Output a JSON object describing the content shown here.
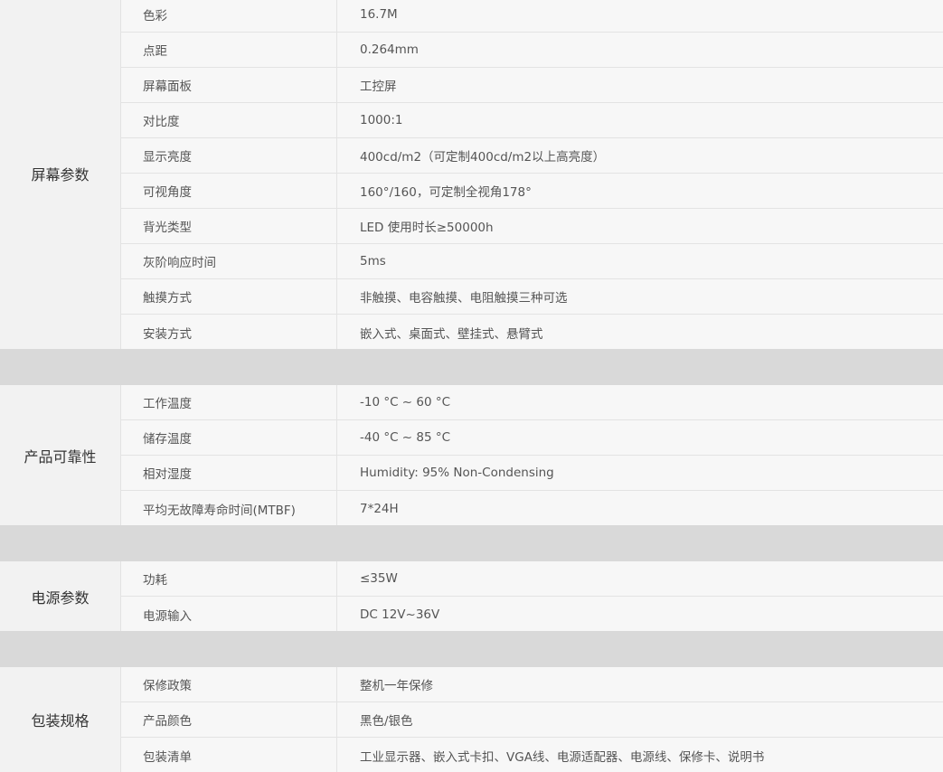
{
  "groups": [
    {
      "category": "屏幕参数",
      "rows": [
        {
          "label": "色彩",
          "value": "16.7M"
        },
        {
          "label": "点距",
          "value": "0.264mm"
        },
        {
          "label": "屏幕面板",
          "value": "工控屏"
        },
        {
          "label": "对比度",
          "value": "1000:1"
        },
        {
          "label": "显示亮度",
          "value": "400cd/m2（可定制400cd/m2以上高亮度）"
        },
        {
          "label": "可视角度",
          "value": "160°/160，可定制全视角178°"
        },
        {
          "label": "背光类型",
          "value": "LED 使用时长≥50000h"
        },
        {
          "label": "灰阶响应时间",
          "value": "5ms"
        },
        {
          "label": "触摸方式",
          "value": "非触摸、电容触摸、电阻触摸三种可选"
        },
        {
          "label": "安装方式",
          "value": "嵌入式、桌面式、壁挂式、悬臂式"
        }
      ]
    },
    {
      "category": "产品可靠性",
      "rows": [
        {
          "label": "工作温度",
          "value": "-10 °C ~ 60 °C"
        },
        {
          "label": "储存温度",
          "value": "-40 °C ~ 85 °C"
        },
        {
          "label": "相对湿度",
          "value": "Humidity: 95% Non-Condensing"
        },
        {
          "label": "平均无故障寿命时间(MTBF)",
          "value": "7*24H"
        }
      ]
    },
    {
      "category": "电源参数",
      "rows": [
        {
          "label": "功耗",
          "value": "≤35W"
        },
        {
          "label": "电源输入",
          "value": "DC 12V~36V"
        }
      ]
    },
    {
      "category": "包装规格",
      "rows": [
        {
          "label": "保修政策",
          "value": "整机一年保修"
        },
        {
          "label": "产品颜色",
          "value": "黑色/银色"
        },
        {
          "label": "包装清单",
          "value": "工业显示器、嵌入式卡扣、VGA线、电源适配器、电源线、保修卡、说明书"
        }
      ]
    }
  ]
}
